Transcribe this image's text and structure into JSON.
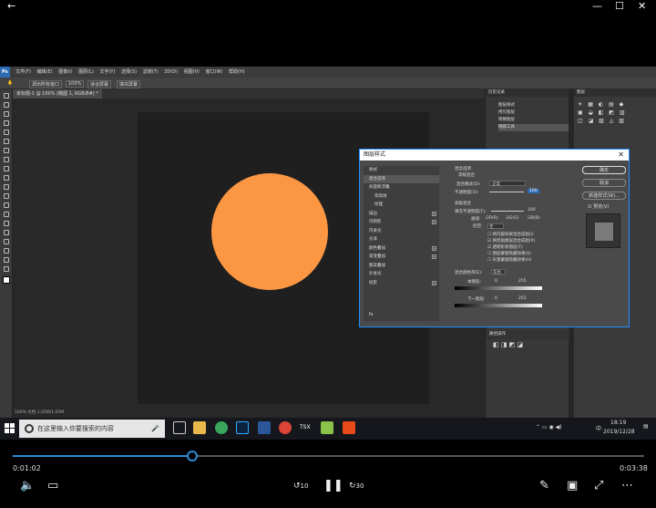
{
  "player": {
    "current_time": "0:01:02",
    "total_time": "0:03:38",
    "progress": 0.284,
    "skip_back_label": "10",
    "skip_forward_label": "30"
  },
  "photoshop": {
    "app_icon": "Ps",
    "menu": [
      "文件(F)",
      "编辑(E)",
      "图像(I)",
      "图层(L)",
      "文字(Y)",
      "选择(S)",
      "滤镜(T)",
      "3D(D)",
      "视图(V)",
      "窗口(W)",
      "帮助(H)"
    ],
    "options": [
      "调出所有窗口",
      "100%",
      "适合屏幕",
      "填充屏幕"
    ],
    "doc_tab": "未标题-1 @ 100% (椭圆 1, RGB/8#) *",
    "history_panel_title": "历史记录",
    "history_items": [
      "图层样式",
      "拷贝图层",
      "转换图层",
      "椭圆工具"
    ],
    "layers_panel_title": "图层",
    "status_bar": "100%    文档:1.05M/1.05M",
    "circle_color": "#fb9743",
    "path_ops_label": "路径操作"
  },
  "dialog": {
    "title": "图层样式",
    "styles_header": "样式",
    "blend_options": "混合选项",
    "effects": [
      {
        "label": "斜面和浮雕",
        "plus": false
      },
      {
        "label": "等高线",
        "plus": false,
        "sub": true
      },
      {
        "label": "纹理",
        "plus": false,
        "sub": true
      },
      {
        "label": "描边",
        "plus": true
      },
      {
        "label": "内阴影",
        "plus": true
      },
      {
        "label": "内发光",
        "plus": false
      },
      {
        "label": "光泽",
        "plus": false
      },
      {
        "label": "颜色叠加",
        "plus": true
      },
      {
        "label": "渐变叠加",
        "plus": true
      },
      {
        "label": "图案叠加",
        "plus": false
      },
      {
        "label": "外发光",
        "plus": false
      },
      {
        "label": "投影",
        "plus": true
      }
    ],
    "fx_label": "fx",
    "general_blending": "常规混合",
    "blend_mode_label": "混合模式(D):",
    "blend_mode_value": "正常",
    "opacity_label": "不透明度(O):",
    "opacity_value": "100",
    "advanced_blending": "高级混合",
    "fill_opacity_label": "填充不透明度(F):",
    "fill_opacity_value": "100",
    "channels_label": "通道:",
    "channel_r": "R(R)",
    "channel_g": "G(G)",
    "channel_b": "B(B)",
    "knockout_label": "挖空:",
    "knockout_value": "无",
    "checks": [
      "将内部效果混合成组(I)",
      "将剪贴图层混合成组(P)",
      "透明形状图层(T)",
      "图层蒙版隐藏效果(S)",
      "矢量蒙版隐藏效果(H)"
    ],
    "blend_if_label": "混合颜色带(E):",
    "blend_if_value": "灰色",
    "this_layer_label": "本图层:",
    "underlying_label": "下一图层:",
    "range_low": "0",
    "range_high": "255",
    "ok": "确定",
    "cancel": "取消",
    "new_style": "新建样式(W)...",
    "preview": "预览(V)"
  },
  "taskbar": {
    "search_placeholder": "在这里输入你要搜索的内容",
    "time": "18:19",
    "date": "2019/12/28",
    "ime": "中"
  }
}
